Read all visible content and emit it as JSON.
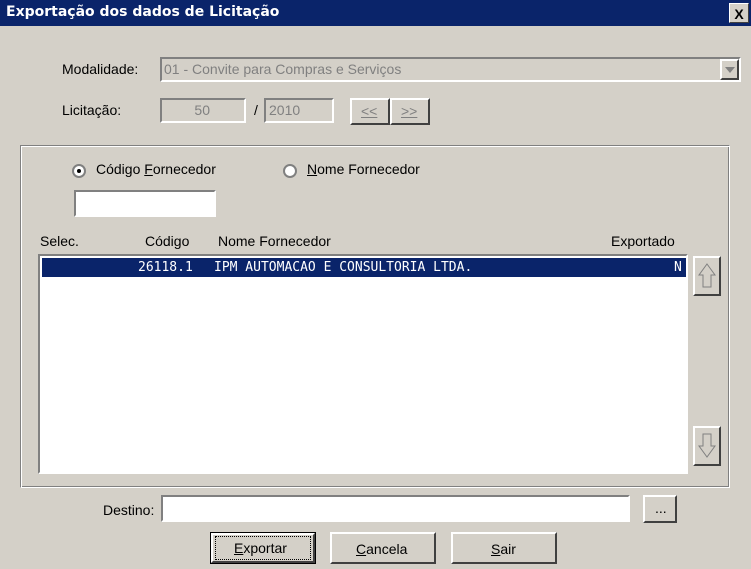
{
  "window": {
    "title": "Exportação dos dados de Licitação",
    "close_glyph": "X"
  },
  "modalidade": {
    "label": "Modalidade:",
    "value": "01 - Convite para Compras e Serviços"
  },
  "licitacao": {
    "label": "Licitação:",
    "numero": "50",
    "separator": "/",
    "ano": "2010",
    "prev_label": "<<",
    "next_label": ">>"
  },
  "search": {
    "radio_codigo_label_pre": "Código ",
    "radio_codigo_label_accel": "F",
    "radio_codigo_label_post": "ornecedor",
    "radio_nome_label_accel": "N",
    "radio_nome_label_post": "ome Fornecedor",
    "selected": "codigo",
    "input_value": ""
  },
  "table": {
    "headers": {
      "selec": "Selec.",
      "codigo": "Código",
      "nome": "Nome Fornecedor",
      "exportado": "Exportado"
    },
    "rows": [
      {
        "codigo": "26118.1",
        "nome": "IPM AUTOMACAO E CONSULTORIA LTDA.",
        "exportado": "N",
        "selected": true
      }
    ]
  },
  "destino": {
    "label": "Destino:",
    "value": "",
    "browse_label": "..."
  },
  "buttons": {
    "exportar_accel": "E",
    "exportar_rest": "xportar",
    "cancela_accel": "C",
    "cancela_rest": "ancela",
    "sair_accel": "S",
    "sair_rest": "air"
  },
  "colors": {
    "titlebar": "#0a246a",
    "face": "#d4d0c8",
    "selection": "#0a246a"
  }
}
